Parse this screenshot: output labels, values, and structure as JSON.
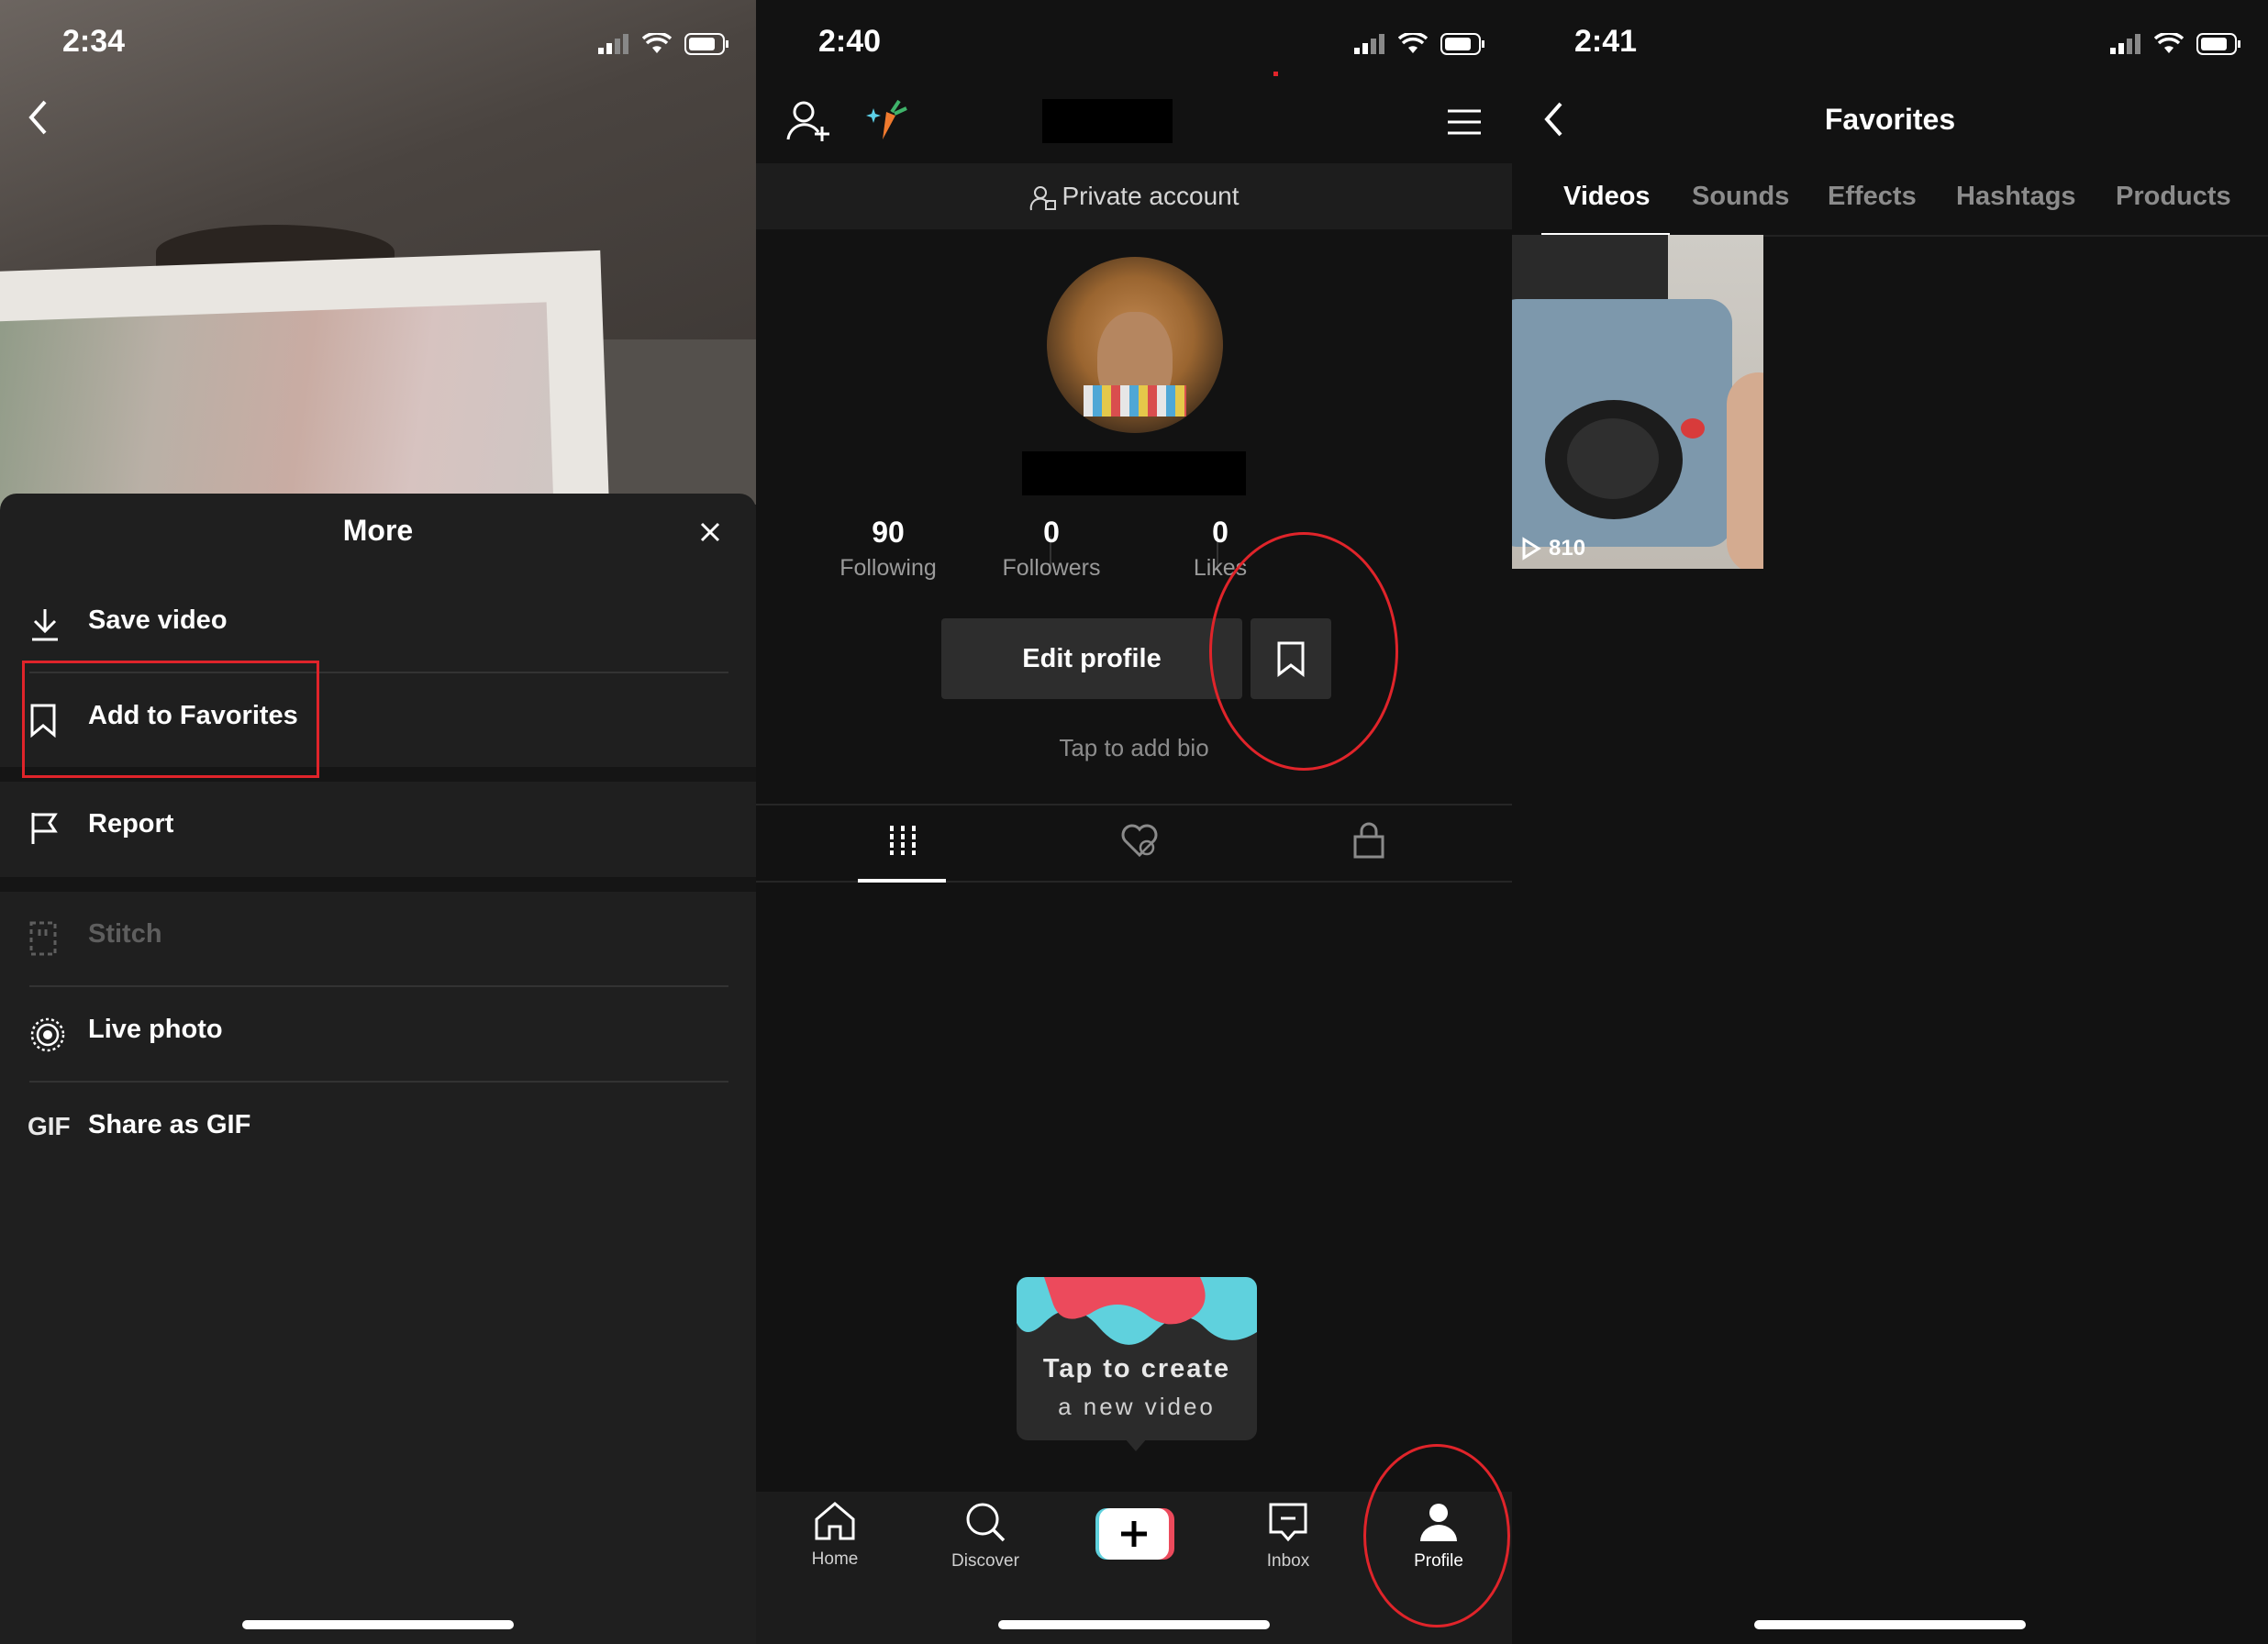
{
  "panel1": {
    "time": "2:34",
    "sheet_title": "More",
    "menu": [
      {
        "label": "Save video",
        "icon": "download-icon",
        "enabled": true
      },
      {
        "label": "Add to Favorites",
        "icon": "bookmark-icon",
        "enabled": true
      },
      {
        "label": "Report",
        "icon": "flag-icon",
        "enabled": true
      },
      {
        "label": "Stitch",
        "icon": "stitch-icon",
        "enabled": false
      },
      {
        "label": "Live photo",
        "icon": "live-photo-icon",
        "enabled": true
      },
      {
        "label": "Share as GIF",
        "icon_text": "GIF",
        "enabled": true
      }
    ],
    "highlight_color": "#e0242a"
  },
  "panel2": {
    "time": "2:40",
    "private_label": "Private account",
    "stats": [
      {
        "value": "90",
        "label": "Following"
      },
      {
        "value": "0",
        "label": "Followers"
      },
      {
        "value": "0",
        "label": "Likes"
      }
    ],
    "edit_profile": "Edit profile",
    "bio_placeholder": "Tap to add bio",
    "create_line1": "Tap to create",
    "create_line2": "a new video",
    "tabbar": [
      {
        "label": "Home",
        "icon": "home-icon"
      },
      {
        "label": "Discover",
        "icon": "search-icon"
      },
      {
        "label": "",
        "icon": "plus-icon"
      },
      {
        "label": "Inbox",
        "icon": "inbox-icon"
      },
      {
        "label": "Profile",
        "icon": "profile-icon",
        "active": true
      }
    ],
    "annotation_color": "#e0242a"
  },
  "panel3": {
    "time": "2:41",
    "title": "Favorites",
    "tabs": [
      "Videos",
      "Sounds",
      "Effects",
      "Hashtags",
      "Products"
    ],
    "active_tab": "Videos",
    "videos": [
      {
        "views": "810"
      }
    ]
  }
}
